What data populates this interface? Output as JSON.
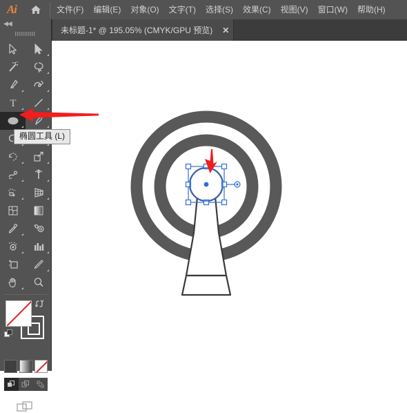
{
  "app": {
    "name": "Ai",
    "logo_icon": "illustrator-logo-icon",
    "home_icon": "home-icon"
  },
  "menubar": {
    "items": [
      {
        "label": "文件(F)",
        "name": "menu-file"
      },
      {
        "label": "编辑(E)",
        "name": "menu-edit"
      },
      {
        "label": "对象(O)",
        "name": "menu-object"
      },
      {
        "label": "文字(T)",
        "name": "menu-type"
      },
      {
        "label": "选择(S)",
        "name": "menu-select"
      },
      {
        "label": "效果(C)",
        "name": "menu-effect"
      },
      {
        "label": "视图(V)",
        "name": "menu-view"
      },
      {
        "label": "窗口(W)",
        "name": "menu-window"
      },
      {
        "label": "帮助(H)",
        "name": "menu-help"
      }
    ]
  },
  "tabbar": {
    "document": {
      "title": "未标题-1* @ 195.05% (CMYK/GPU 预览)",
      "close_label": "✕",
      "zoom": "195.05%",
      "color_mode": "CMYK",
      "preview_mode": "GPU 预览"
    }
  },
  "toolbar": {
    "collapse_label": "◀◀",
    "tools": [
      {
        "name": "selection-tool",
        "icon": "arrow-cursor-icon",
        "has_flyout": false,
        "active": false
      },
      {
        "name": "direct-selection-tool",
        "icon": "white-arrow-cursor-icon",
        "has_flyout": true,
        "active": false
      },
      {
        "name": "magic-wand-tool",
        "icon": "magic-wand-icon",
        "has_flyout": false,
        "active": false
      },
      {
        "name": "lasso-tool",
        "icon": "lasso-icon",
        "has_flyout": true,
        "active": false
      },
      {
        "name": "pen-tool",
        "icon": "pen-nib-icon",
        "has_flyout": true,
        "active": false
      },
      {
        "name": "curvature-tool",
        "icon": "curvature-icon",
        "has_flyout": true,
        "active": false
      },
      {
        "name": "type-tool",
        "icon": "type-t-icon",
        "has_flyout": true,
        "active": false
      },
      {
        "name": "line-segment-tool",
        "icon": "line-diagonal-icon",
        "has_flyout": true,
        "active": false
      },
      {
        "name": "ellipse-tool",
        "icon": "ellipse-icon",
        "has_flyout": true,
        "active": true
      },
      {
        "name": "paintbrush-tool",
        "icon": "paintbrush-icon",
        "has_flyout": true,
        "active": false
      },
      {
        "name": "shaper-tool",
        "icon": "shaper-icon",
        "has_flyout": true,
        "active": false
      },
      {
        "name": "eraser-tool",
        "icon": "eraser-icon",
        "has_flyout": true,
        "active": false
      },
      {
        "name": "rotate-tool",
        "icon": "rotate-icon",
        "has_flyout": true,
        "active": false
      },
      {
        "name": "scale-tool",
        "icon": "scale-icon",
        "has_flyout": true,
        "active": false
      },
      {
        "name": "width-tool",
        "icon": "width-icon",
        "has_flyout": true,
        "active": false
      },
      {
        "name": "free-transform-tool",
        "icon": "pushpin-icon",
        "has_flyout": true,
        "active": false
      },
      {
        "name": "shape-builder-tool",
        "icon": "shape-builder-icon",
        "has_flyout": true,
        "active": false
      },
      {
        "name": "perspective-grid-tool",
        "icon": "perspective-grid-icon",
        "has_flyout": true,
        "active": false
      },
      {
        "name": "mesh-tool",
        "icon": "mesh-icon",
        "has_flyout": false,
        "active": false
      },
      {
        "name": "gradient-tool",
        "icon": "gradient-icon",
        "has_flyout": false,
        "active": false
      },
      {
        "name": "eyedropper-tool",
        "icon": "eyedropper-icon",
        "has_flyout": true,
        "active": false
      },
      {
        "name": "blend-tool",
        "icon": "blend-icon",
        "has_flyout": false,
        "active": false
      },
      {
        "name": "symbol-sprayer-tool",
        "icon": "symbol-sprayer-icon",
        "has_flyout": true,
        "active": false
      },
      {
        "name": "column-graph-tool",
        "icon": "bar-chart-icon",
        "has_flyout": true,
        "active": false
      },
      {
        "name": "artboard-tool",
        "icon": "artboard-icon",
        "has_flyout": false,
        "active": false
      },
      {
        "name": "slice-tool",
        "icon": "knife-icon",
        "has_flyout": true,
        "active": false
      },
      {
        "name": "hand-tool",
        "icon": "hand-icon",
        "has_flyout": true,
        "active": false
      },
      {
        "name": "zoom-tool",
        "icon": "magnifier-icon",
        "has_flyout": false,
        "active": false
      }
    ],
    "color_controls": {
      "fill_label": "fill-swatch",
      "stroke_label": "stroke-swatch",
      "fill_state": "none",
      "swap_icon": "swap-fill-stroke-icon",
      "default_icon": "default-fill-stroke-icon",
      "modes": [
        {
          "name": "color-mode-button",
          "icon": "solid-color-icon",
          "selected": false
        },
        {
          "name": "gradient-mode-button",
          "icon": "gradient-swatch-icon",
          "selected": false
        },
        {
          "name": "none-mode-button",
          "icon": "none-slash-icon",
          "selected": true
        }
      ],
      "draw_modes": [
        {
          "name": "draw-normal-button",
          "icon": "draw-normal-icon",
          "active": true
        },
        {
          "name": "draw-behind-button",
          "icon": "draw-behind-icon",
          "active": false
        },
        {
          "name": "draw-inside-button",
          "icon": "draw-inside-icon",
          "active": false
        }
      ],
      "screen_mode": {
        "name": "screen-mode-button",
        "icon": "screen-mode-icon"
      }
    }
  },
  "tooltip": {
    "text": "椭圆工具 (L)",
    "tool_name": "椭圆工具",
    "shortcut": "(L)"
  },
  "canvas": {
    "artwork_name": "radar-tower-artwork",
    "ring_color": "#595959",
    "outline_color": "#3a3a3a",
    "selection_color": "#2f6fd8",
    "annotation_color": "#f01e1e",
    "selection": {
      "name": "ellipse-selection-bbox",
      "handle_count": 8,
      "has_center_point": true,
      "has_widget_handle": true
    },
    "annotations": [
      {
        "name": "arrow-to-ellipse-tool",
        "direction": "left"
      },
      {
        "name": "arrow-to-selected-ellipse",
        "direction": "down"
      }
    ]
  }
}
